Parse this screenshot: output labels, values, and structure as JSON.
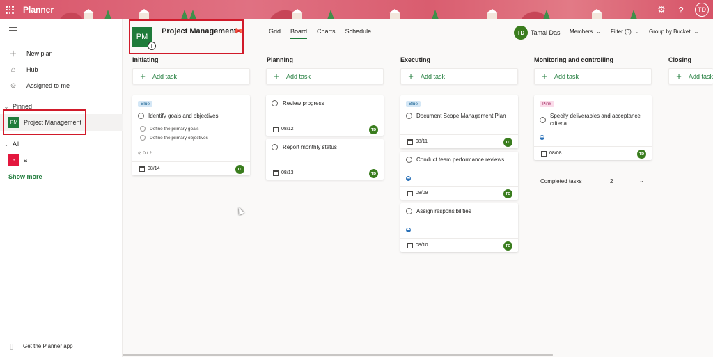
{
  "app": {
    "name": "Planner",
    "user_initials": "TD"
  },
  "sidebar": {
    "new_plan": "New plan",
    "hub": "Hub",
    "assigned": "Assigned to me",
    "pinned_label": "Pinned",
    "pinned_item": {
      "initials": "PM",
      "name": "Project Management"
    },
    "all_label": "All",
    "all_item": {
      "initials": "a",
      "name": "a"
    },
    "show_more": "Show more",
    "get_app": "Get the Planner app"
  },
  "header": {
    "plan_initials": "PM",
    "plan_title": "Project Management",
    "tabs": [
      "Grid",
      "Board",
      "Charts",
      "Schedule"
    ],
    "active_tab": "Board",
    "user_initials": "TD",
    "user_name": "Tamal Das",
    "members": "Members",
    "filter": "Filter (0)",
    "group_by": "Group by Bucket"
  },
  "buckets": [
    {
      "title": "Initiating",
      "add_task": "Add task"
    },
    {
      "title": "Planning",
      "add_task": "Add task"
    },
    {
      "title": "Executing",
      "add_task": "Add task"
    },
    {
      "title": "Monitoring and controlling",
      "add_task": "Add task"
    },
    {
      "title": "Closing",
      "add_task": "Add task"
    }
  ],
  "cards": {
    "identify": {
      "label": "Blue",
      "title": "Identify goals and objectives",
      "checklist": [
        "Define the primary goals",
        "Define the primary objectives"
      ],
      "checklist_count": "0 / 2",
      "date": "08/14",
      "assignee": "TD"
    },
    "review": {
      "title": "Review progress",
      "date": "08/12",
      "assignee": "TD"
    },
    "report": {
      "title": "Report monthly status",
      "date": "08/13",
      "assignee": "TD"
    },
    "document": {
      "label": "Blue",
      "title": "Document Scope Management Plan",
      "date": "08/11",
      "assignee": "TD"
    },
    "conduct": {
      "title": "Conduct team performance reviews",
      "date": "08/09",
      "assignee": "TD"
    },
    "assign": {
      "title": "Assign responsibilities",
      "date": "08/10",
      "assignee": "TD"
    },
    "specify": {
      "label": "Pink",
      "title": "Specify deliverables and acceptance criteria",
      "date": "08/08",
      "assignee": "TD"
    }
  },
  "completed": {
    "label": "Completed tasks",
    "count": "2"
  },
  "colors": {
    "brand": "#1e7b3a",
    "highlight": "#d11a2a",
    "topbar": "#d9566a"
  }
}
